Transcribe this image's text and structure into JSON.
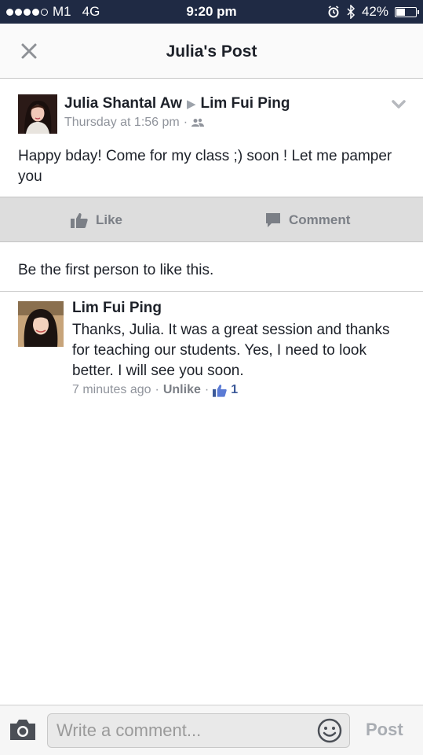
{
  "status_bar": {
    "carrier": "M1",
    "network": "4G",
    "time": "9:20 pm",
    "battery": "42%",
    "battery_level": 0.42
  },
  "header": {
    "title": "Julia's Post",
    "close_icon": "close-icon"
  },
  "post": {
    "author": "Julia Shantal Aw",
    "target": "Lim Fui Ping",
    "timestamp": "Thursday at 1:56 pm",
    "separator": "·",
    "audience_icon": "friends-icon",
    "text": "Happy bday! Come for my class ;) soon ! Let me pamper you"
  },
  "actions": {
    "like_label": "Like",
    "comment_label": "Comment"
  },
  "likes_summary": "Be the first person to like this.",
  "comments": [
    {
      "author": "Lim Fui Ping",
      "text": "Thanks, Julia. It was a great session and thanks for teaching our students. Yes, I need to look better. I will see you soon.",
      "time": "7 minutes ago",
      "unlike_label": "Unlike",
      "like_count": "1"
    }
  ],
  "composer": {
    "placeholder": "Write a comment...",
    "post_label": "Post"
  },
  "colors": {
    "status_bar": "#1f2a44",
    "accent": "#3b5998",
    "action_bar": "#dddddd"
  }
}
